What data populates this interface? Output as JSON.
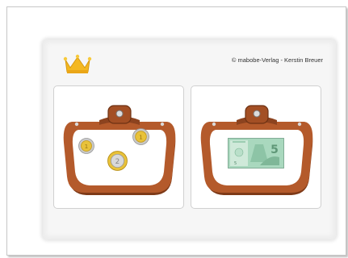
{
  "credit": "© mabobe-Verlag - Kerstin Breuer",
  "colors": {
    "purse_leather": "#b45a2b",
    "purse_dark": "#7e3a18",
    "coin_gold": "#e8c23a",
    "coin_silver": "#c9c9c9",
    "note_green": "#8ec9a8",
    "crown": "#f4b820"
  },
  "panels": [
    {
      "id": "left",
      "content": [
        "2-euro-coin",
        "1-euro-coin",
        "1-euro-coin"
      ]
    },
    {
      "id": "right",
      "content": [
        "5-euro-note"
      ]
    }
  ],
  "banknote": {
    "denomination": "5",
    "label": "5 euro"
  }
}
